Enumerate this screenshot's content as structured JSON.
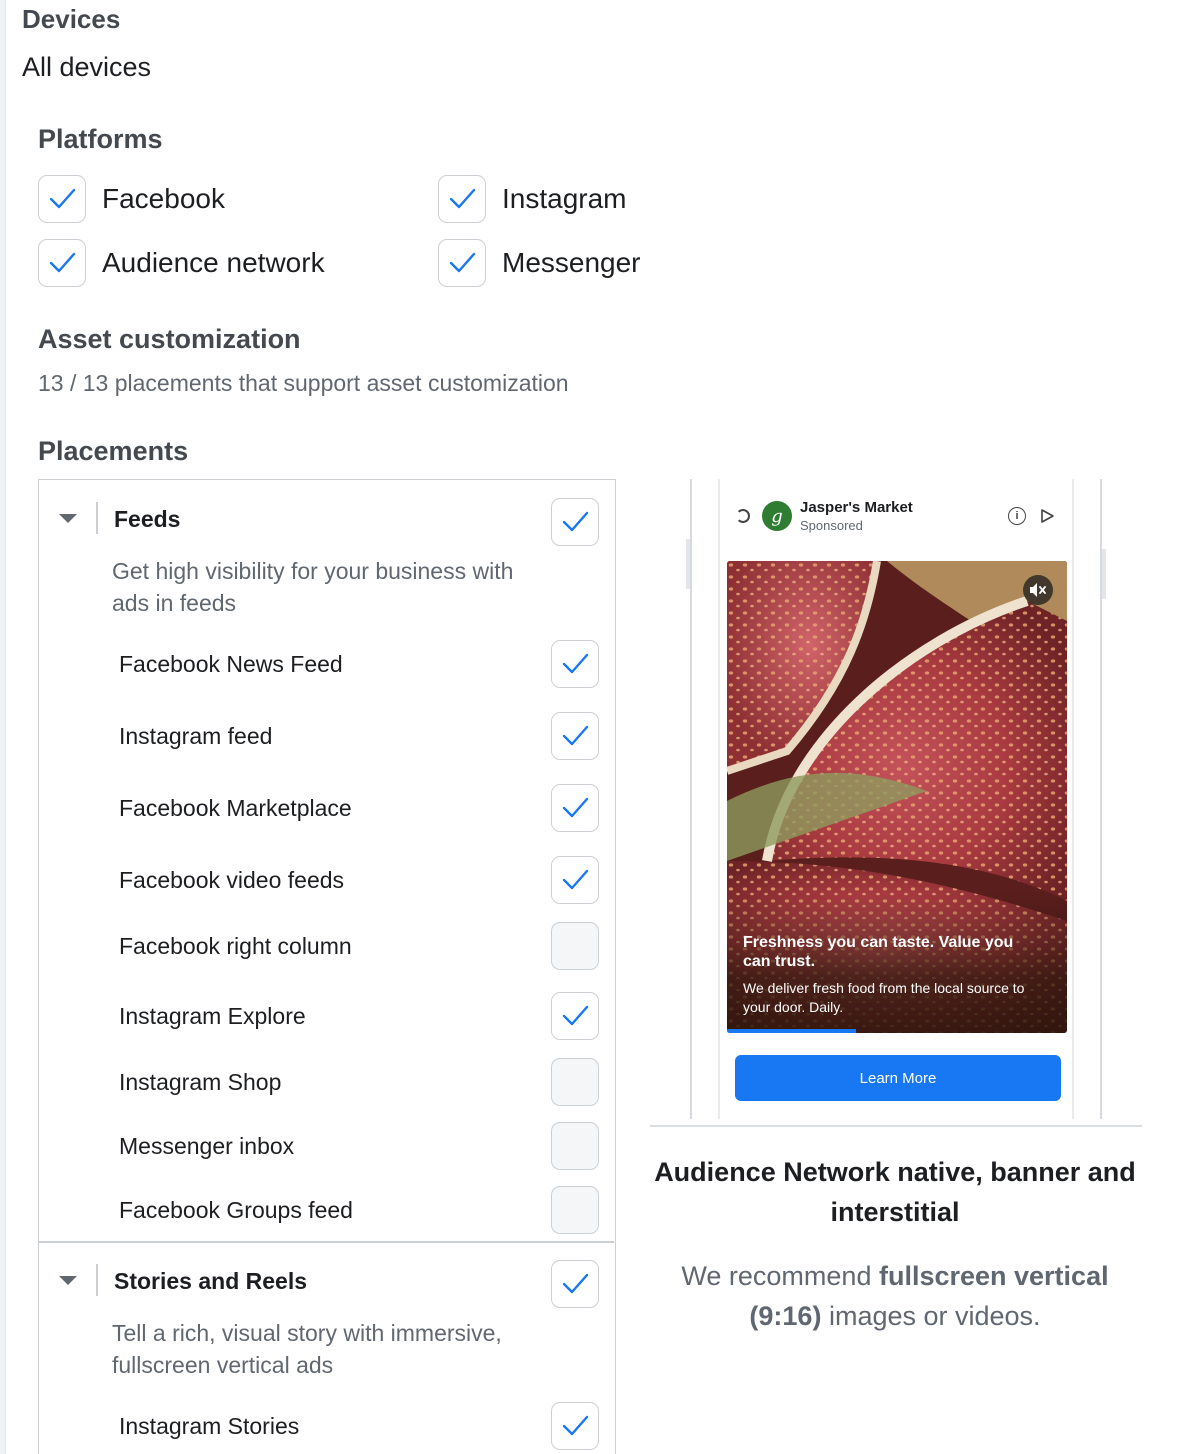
{
  "devices": {
    "heading": "Devices",
    "value": "All devices"
  },
  "platforms": {
    "heading": "Platforms",
    "items": [
      {
        "label": "Facebook",
        "checked": true
      },
      {
        "label": "Instagram",
        "checked": true
      },
      {
        "label": "Audience network",
        "checked": true
      },
      {
        "label": "Messenger",
        "checked": true
      }
    ]
  },
  "asset_customization": {
    "heading": "Asset customization",
    "subtitle": "13 / 13 placements that support asset customization"
  },
  "placements": {
    "heading": "Placements",
    "groups": [
      {
        "title": "Feeds",
        "description": "Get high visibility for your business with ads in feeds",
        "checked": true,
        "items": [
          {
            "label": "Facebook News Feed",
            "checked": true
          },
          {
            "label": "Instagram feed",
            "checked": true
          },
          {
            "label": "Facebook Marketplace",
            "checked": true
          },
          {
            "label": "Facebook video feeds",
            "checked": true
          },
          {
            "label": "Facebook right column",
            "checked": false
          },
          {
            "label": "Instagram Explore",
            "checked": true
          },
          {
            "label": "Instagram Shop",
            "checked": false
          },
          {
            "label": "Messenger inbox",
            "checked": false
          },
          {
            "label": "Facebook Groups feed",
            "checked": false
          }
        ]
      },
      {
        "title": "Stories and Reels",
        "description": "Tell a rich, visual story with immersive, fullscreen vertical ads",
        "checked": true,
        "items": [
          {
            "label": "Instagram Stories",
            "checked": true
          }
        ]
      }
    ]
  },
  "preview": {
    "ad": {
      "advertiser": "Jasper's Market",
      "avatar_letter": "g",
      "sponsored": "Sponsored",
      "headline": "Freshness you can taste. Value you can trust.",
      "body": "We deliver fresh food from the local source to your door. Daily.",
      "cta": "Learn More",
      "video_progress": 0.38
    },
    "title": "Audience Network native, banner and interstitial",
    "recommendation_prefix": "We recommend ",
    "recommendation_bold": "fullscreen vertical (9:16)",
    "recommendation_suffix": " images or videos."
  },
  "colors": {
    "accent": "#1877f2",
    "check": "#1877f2",
    "border": "#ccd0d5",
    "muted_text": "#606770"
  },
  "icons": {
    "check": "checkmark-icon",
    "caret": "caret-down-icon",
    "mute": "mute-icon",
    "info": "info-icon",
    "adchoices": "adchoices-icon"
  }
}
